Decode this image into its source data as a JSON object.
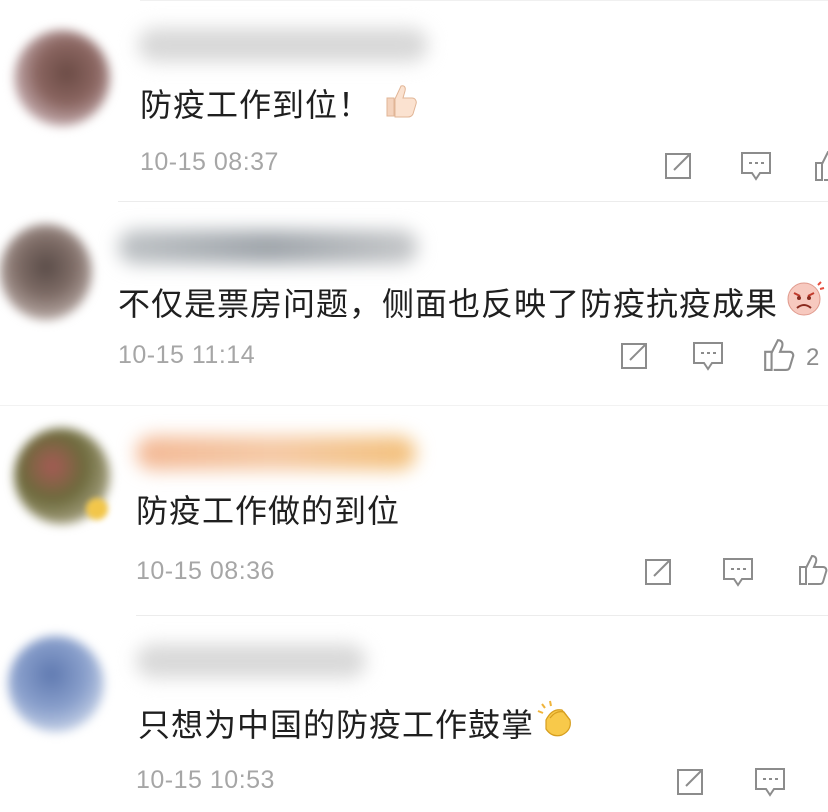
{
  "comments": [
    {
      "text": "防疫工作到位！",
      "emoji": "thumbs-up-icon",
      "time": "10-15 08:37",
      "like_count": ""
    },
    {
      "text": "不仅是票房问题，侧面也反映了防疫抗疫成果",
      "emoji": "angry-face-icon",
      "time": "10-15 11:14",
      "like_count": "2"
    },
    {
      "text": "防疫工作做的到位",
      "emoji": "",
      "time": "10-15 08:36",
      "like_count": ""
    },
    {
      "text": "只想为中国的防疫工作鼓掌",
      "emoji": "clapping-hands-icon",
      "time": "10-15 10:53",
      "like_count": ""
    }
  ],
  "colors": {
    "text": "#1f1f1f",
    "timestamp": "#a6a6a6",
    "icon_gray": "#8c8c8c",
    "divider": "#ececec",
    "highlight_username": "#f5c08a"
  }
}
